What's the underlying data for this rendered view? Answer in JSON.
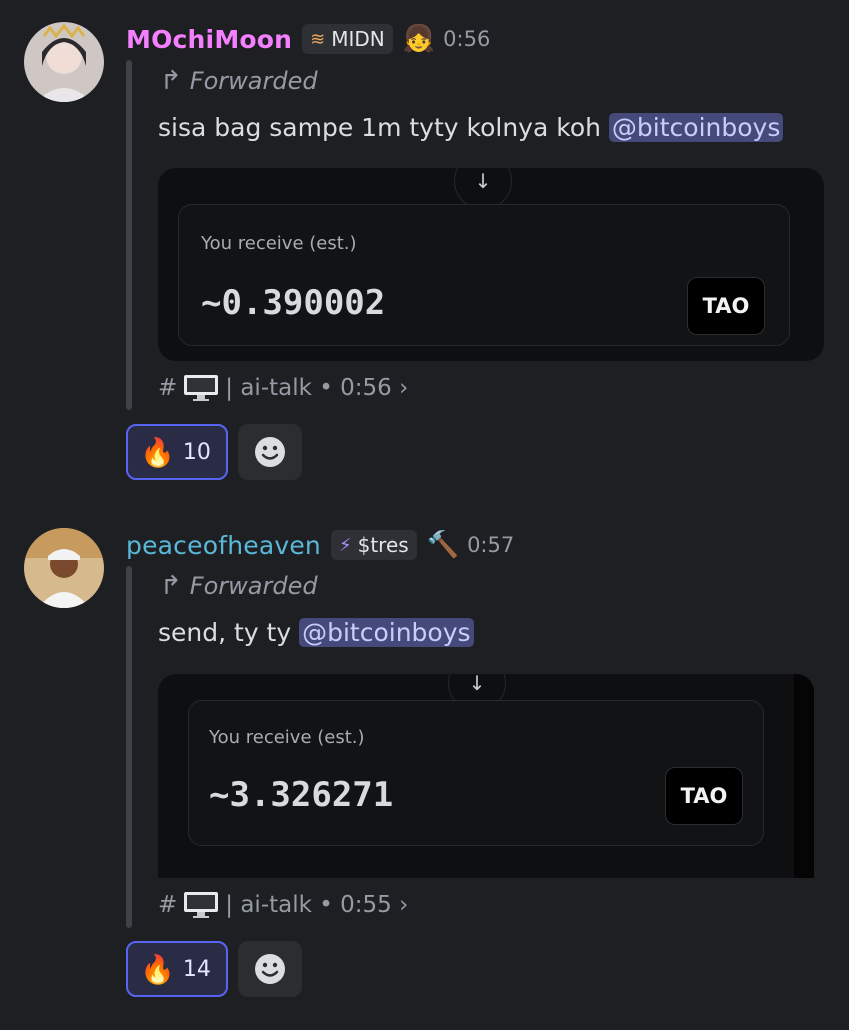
{
  "messages": [
    {
      "username": "MOchiMoon",
      "username_color": "#f47fff",
      "tag_icon": "stack-coins-icon",
      "tag_glyph": "≋",
      "tag_label": "MIDN",
      "badge_icon": "anime-girl-emoji",
      "badge_glyph": "👧",
      "time": "0:56",
      "forwarded_label": "Forwarded",
      "text": "sisa bag sampe 1m tyty kolnya koh ",
      "mention": "@bitcoinboys",
      "embed": {
        "receive_label": "You receive (est.)",
        "amount": "~0.390002",
        "token": "TAO"
      },
      "channel_hash": "#",
      "channel_name": "| ai-talk • 0:56 ›",
      "reaction": {
        "emoji": "🔥",
        "count": "10"
      }
    },
    {
      "username": "peaceofheaven",
      "username_color": "#5ab7d8",
      "tag_icon": "lightning-icon",
      "tag_glyph": "⚡",
      "tag_label": "$tres",
      "badge_icon": "ban-hammer-emoji",
      "badge_glyph": "🔨",
      "time": "0:57",
      "forwarded_label": "Forwarded",
      "text": "send, ty ty ",
      "mention": "@bitcoinboys",
      "embed": {
        "receive_label": "You receive (est.)",
        "amount": "~3.326271",
        "token": "TAO"
      },
      "channel_hash": "#",
      "channel_name": "| ai-talk • 0:55 ›",
      "reaction": {
        "emoji": "🔥",
        "count": "14"
      }
    }
  ],
  "colors": {
    "background": "#1e1f22",
    "mention_bg": "#454a7a",
    "reaction_border": "#5865f2"
  }
}
